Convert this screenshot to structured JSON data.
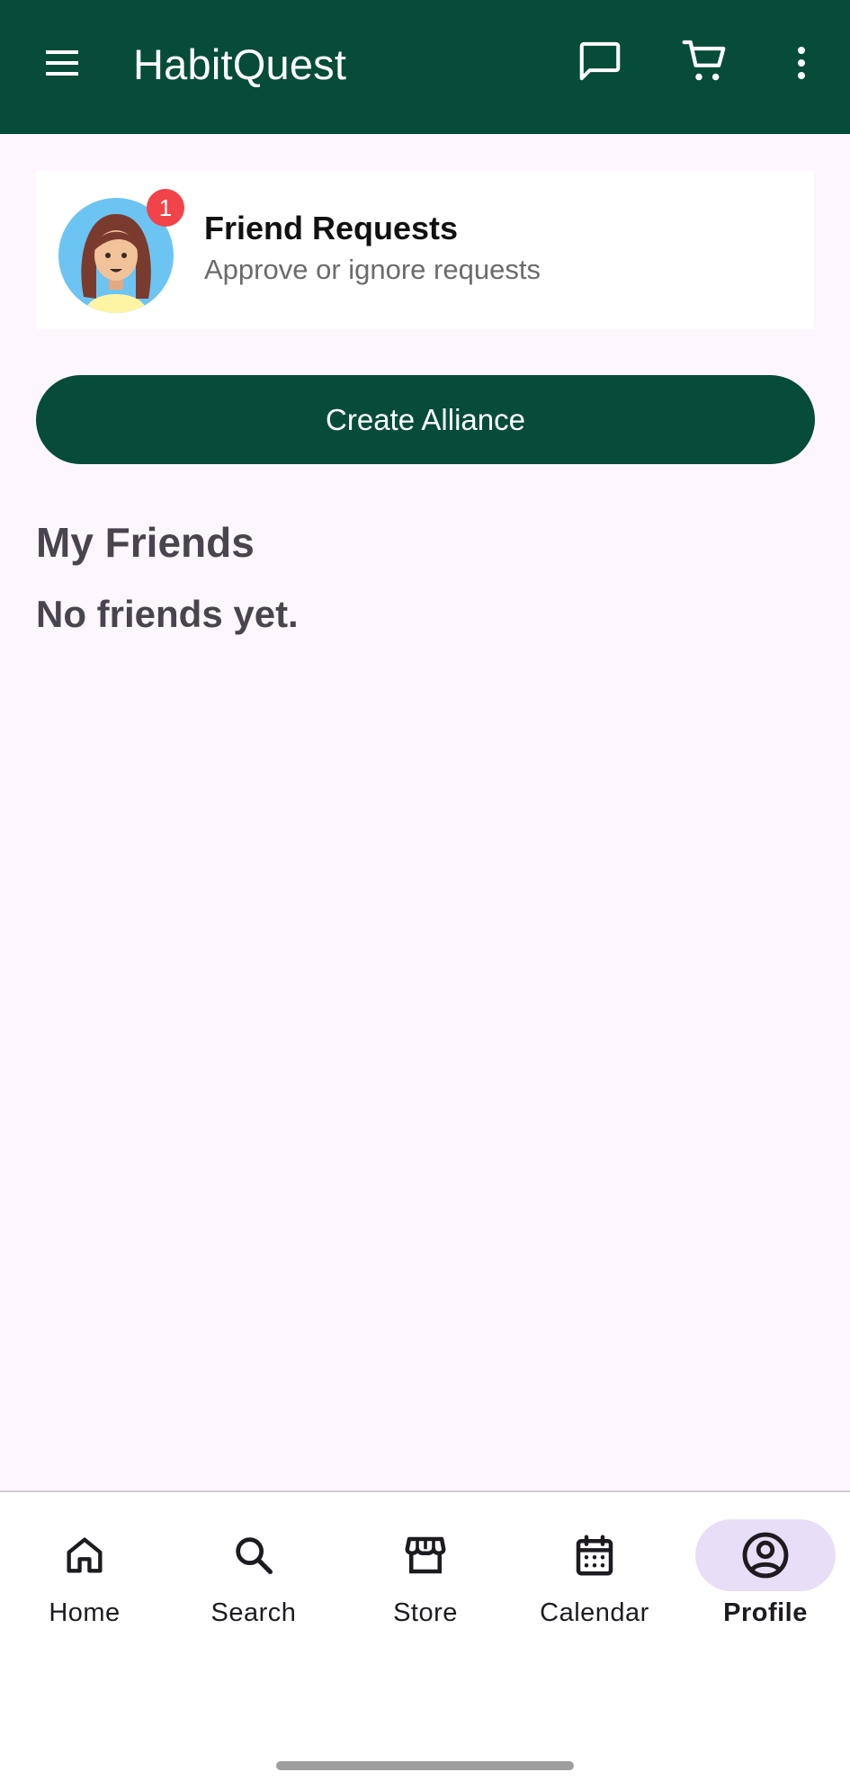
{
  "appbar": {
    "title": "HabitQuest",
    "background": "#064c39",
    "icons": [
      "menu-icon",
      "chat-icon",
      "cart-icon",
      "more-vert-icon"
    ]
  },
  "friend_requests": {
    "title": "Friend Requests",
    "subtitle": "Approve or ignore requests",
    "badge_count": "1",
    "badge_color": "#f2434a"
  },
  "create_alliance": {
    "label": "Create Alliance"
  },
  "friends": {
    "heading": "My Friends",
    "empty_message": "No friends yet."
  },
  "bottom_nav": {
    "items": [
      {
        "label": "Home",
        "icon": "home-icon"
      },
      {
        "label": "Search",
        "icon": "search-icon"
      },
      {
        "label": "Store",
        "icon": "store-icon"
      },
      {
        "label": "Calendar",
        "icon": "calendar-icon"
      },
      {
        "label": "Profile",
        "icon": "account-circle-icon",
        "active": true
      }
    ],
    "active_indicator_color": "#e8def8"
  }
}
